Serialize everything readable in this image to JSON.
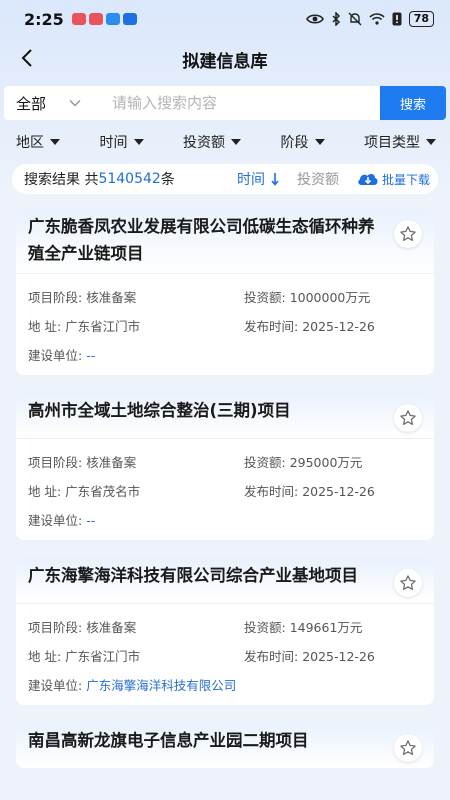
{
  "status": {
    "time": "2:25",
    "battery": "78"
  },
  "nav": {
    "title": "拟建信息库"
  },
  "search": {
    "scope": "全部",
    "placeholder": "请输入搜索内容",
    "value": "",
    "button": "搜索"
  },
  "filters": [
    {
      "label": "地区"
    },
    {
      "label": "时间"
    },
    {
      "label": "投资额"
    },
    {
      "label": "阶段"
    },
    {
      "label": "项目类型"
    }
  ],
  "results": {
    "label": "搜索结果 共",
    "count": "5140542",
    "unit": "条",
    "sort_time": "时间",
    "sort_invest": "投资额",
    "batch_download": "批量下载"
  },
  "labels": {
    "stage": "项目阶段:",
    "invest": "投资额:",
    "address": "地 址:",
    "publish": "发布时间:",
    "builder": "建设单位:"
  },
  "projects": [
    {
      "title": "广东脆香凤农业发展有限公司低碳生态循环种养殖全产业链项目",
      "stage": "核准备案",
      "invest": "1000000万元",
      "address": "广东省江门市",
      "publish": "2025-12-26",
      "builder": "--"
    },
    {
      "title": "高州市全域土地综合整治(三期)项目",
      "stage": "核准备案",
      "invest": "295000万元",
      "address": "广东省茂名市",
      "publish": "2025-12-26",
      "builder": "--"
    },
    {
      "title": "广东海擎海洋科技有限公司综合产业基地项目",
      "stage": "核准备案",
      "invest": "149661万元",
      "address": "广东省江门市",
      "publish": "2025-12-26",
      "builder": "广东海擎海洋科技有限公司"
    },
    {
      "title": "南昌高新龙旗电子信息产业园二期项目"
    }
  ],
  "colors": {
    "accent": "#1e7bf0",
    "link": "#2a6fd6"
  }
}
